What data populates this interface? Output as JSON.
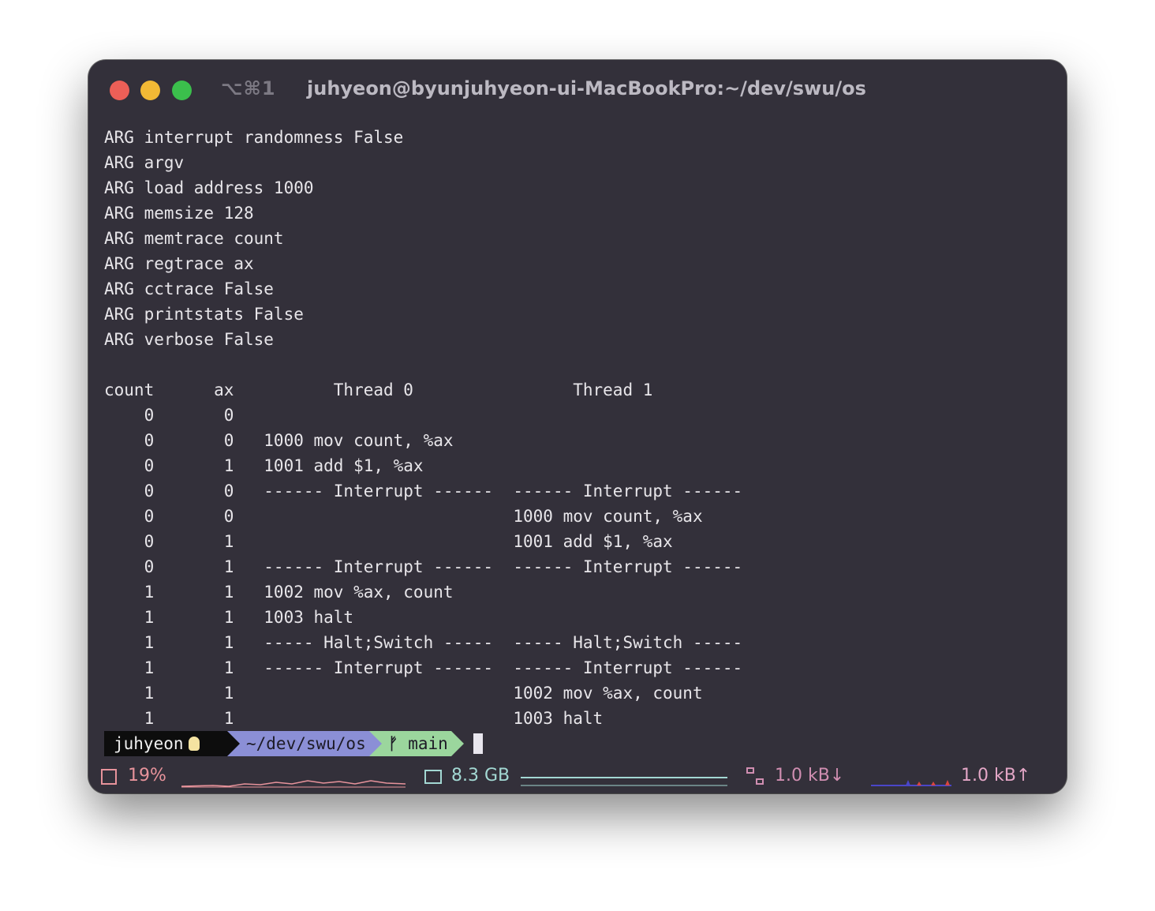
{
  "window": {
    "tab_shortcut": "⌥⌘1",
    "title": "juhyeon@byunjuhyeon-ui-MacBookPro:~/dev/swu/os"
  },
  "terminal": {
    "lines": [
      "ARG interrupt randomness False",
      "ARG argv",
      "ARG load address 1000",
      "ARG memsize 128",
      "ARG memtrace count",
      "ARG regtrace ax",
      "ARG cctrace False",
      "ARG printstats False",
      "ARG verbose False",
      "",
      "count      ax          Thread 0                Thread 1",
      "    0       0",
      "    0       0   1000 mov count, %ax",
      "    0       1   1001 add $1, %ax",
      "    0       0   ------ Interrupt ------  ------ Interrupt ------",
      "    0       0                            1000 mov count, %ax",
      "    0       1                            1001 add $1, %ax",
      "    0       1   ------ Interrupt ------  ------ Interrupt ------",
      "    1       1   1002 mov %ax, count",
      "    1       1   1003 halt",
      "    1       1   ----- Halt;Switch -----  ----- Halt;Switch -----",
      "    1       1   ------ Interrupt ------  ------ Interrupt ------",
      "    1       1                            1002 mov %ax, count",
      "    1       1                            1003 halt"
    ]
  },
  "prompt": {
    "user": "juhyeon",
    "path": "~/dev/swu/os",
    "branch_icon": "git-branch-icon",
    "branch": "main"
  },
  "status": {
    "cpu": "19%",
    "memory": "8.3 GB",
    "net_down": "1.0 kB↓",
    "net_up": "1.0 kB↑",
    "colors": {
      "cpu": "#e7939b",
      "memory": "#a3d8d3",
      "network": "#d08eb1"
    }
  }
}
